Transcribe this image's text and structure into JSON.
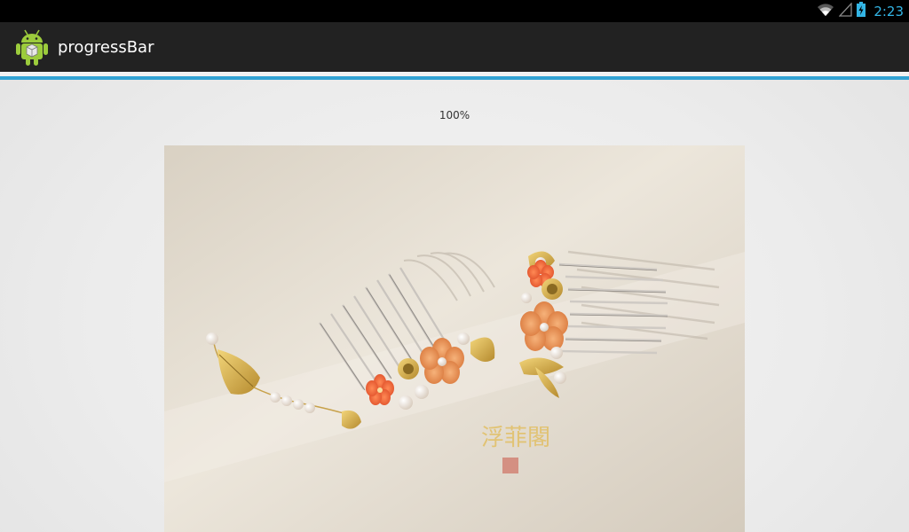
{
  "status_bar": {
    "time": "2:23",
    "icons": [
      "wifi-icon",
      "signal-icon",
      "battery-charging-icon"
    ],
    "accent_color": "#33b5e5"
  },
  "action_bar": {
    "title": "progressBar",
    "icon": "android-icon"
  },
  "progress": {
    "value": 1.0,
    "label": "100%",
    "color": "#33a3d4"
  },
  "image": {
    "description_icon": "hair-comb-photo",
    "watermark": "浮菲閣"
  }
}
